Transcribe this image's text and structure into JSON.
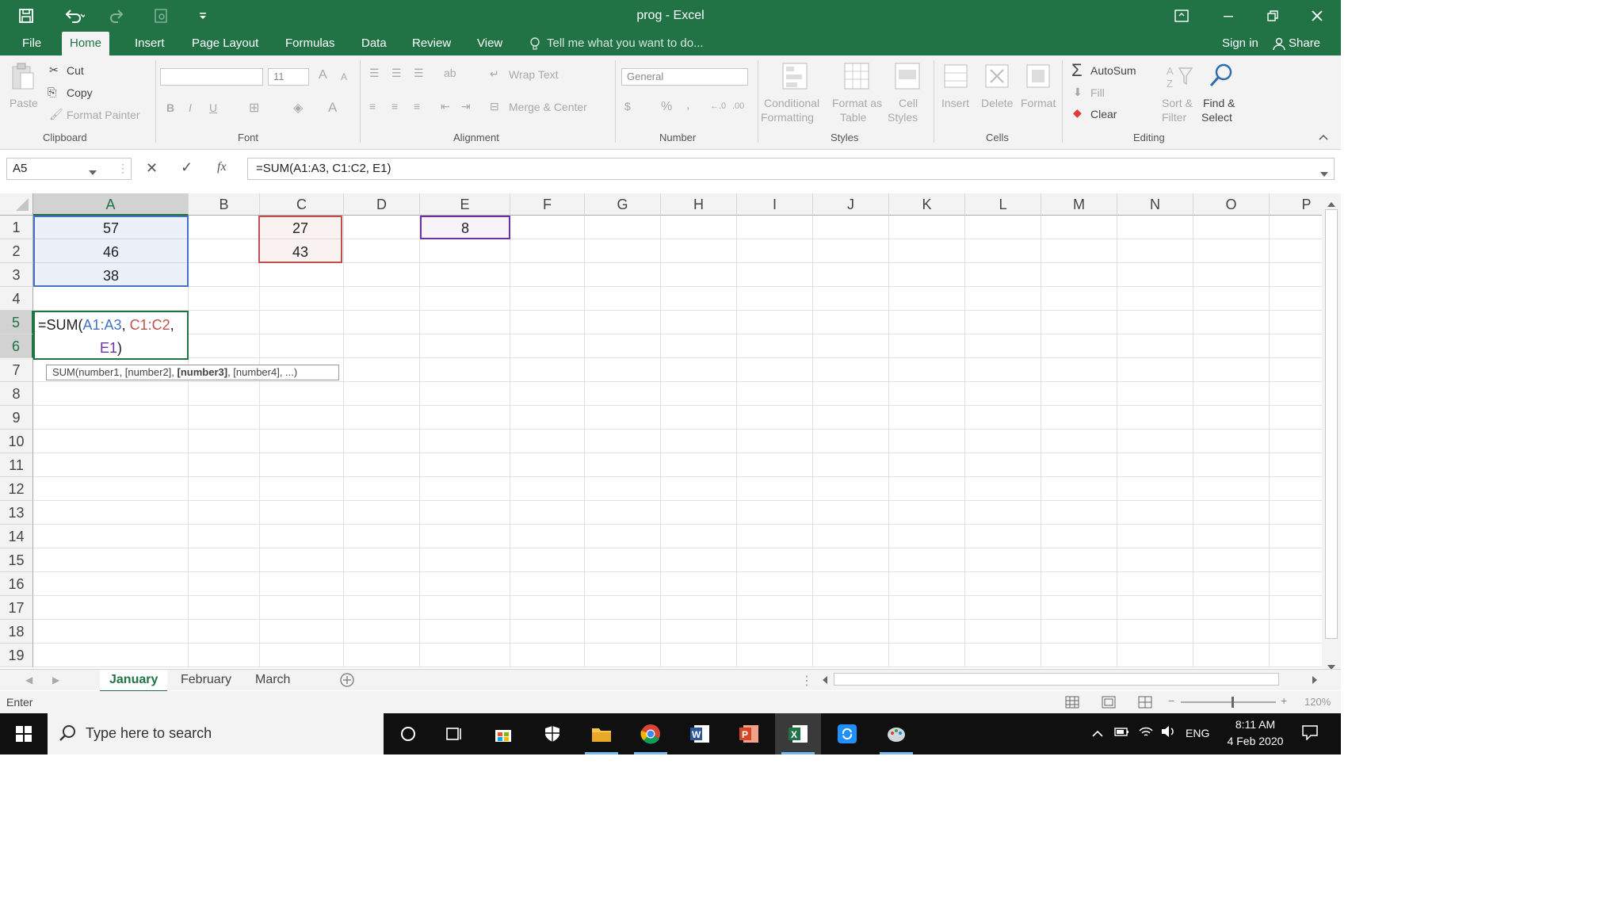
{
  "window": {
    "title": "prog - Excel"
  },
  "ribbon_tabs": [
    {
      "label": "File"
    },
    {
      "label": "Home"
    },
    {
      "label": "Insert"
    },
    {
      "label": "Page Layout"
    },
    {
      "label": "Formulas"
    },
    {
      "label": "Data"
    },
    {
      "label": "Review"
    },
    {
      "label": "View"
    }
  ],
  "tell_me": "Tell me what you want to do...",
  "account": {
    "sign_in": "Sign in",
    "share": "Share"
  },
  "clipboard": {
    "paste": "Paste",
    "cut": "Cut",
    "copy": "Copy",
    "format_painter": "Format Painter",
    "group": "Clipboard"
  },
  "font": {
    "name": "",
    "size": "11",
    "bold": "B",
    "italic": "I",
    "underline": "U",
    "group": "Font",
    "grow": "A",
    "shrink": "A",
    "color": "A"
  },
  "alignment": {
    "wrap_text": "Wrap Text",
    "merge_center": "Merge & Center",
    "group": "Alignment"
  },
  "number": {
    "format": "General",
    "percent": "%",
    "comma": ",",
    "group": "Number"
  },
  "styles": {
    "conditional_1": "Conditional",
    "conditional_2": "Formatting",
    "format_table_1": "Format as",
    "format_table_2": "Table",
    "cell_styles_1": "Cell",
    "cell_styles_2": "Styles",
    "group": "Styles"
  },
  "cells": {
    "insert": "Insert",
    "delete": "Delete",
    "format": "Format",
    "group": "Cells"
  },
  "editing": {
    "autosum": "AutoSum",
    "fill": "Fill",
    "clear": "Clear",
    "sort_1": "Sort &",
    "sort_2": "Filter",
    "find_1": "Find &",
    "find_2": "Select",
    "group": "Editing"
  },
  "formula_bar": {
    "name_box": "A5",
    "cancel": "✕",
    "enter": "✓",
    "fx": "fx",
    "formula": "=SUM(A1:A3, C1:C2, E1)"
  },
  "columns": [
    "A",
    "B",
    "C",
    "D",
    "E",
    "F",
    "G",
    "H",
    "I",
    "J",
    "K",
    "L",
    "M",
    "N",
    "O",
    "P"
  ],
  "rows": [
    "1",
    "2",
    "3",
    "4",
    "5",
    "6",
    "7",
    "8",
    "9",
    "10",
    "11",
    "12",
    "13",
    "14",
    "15",
    "16",
    "17",
    "18",
    "19"
  ],
  "cells_data": {
    "A1": "57",
    "A2": "46",
    "A3": "38",
    "C1": "27",
    "C2": "43",
    "E1": "8"
  },
  "edit_formula": {
    "prefix": "=SUM(",
    "ref1": "A1:A3",
    "sep1": ", ",
    "ref2": "C1:C2",
    "sep2": ",",
    "ref3": "E1",
    "suffix": ")"
  },
  "tooltip": {
    "pre": "SUM(number1, [number2], ",
    "bold": "[number3]",
    "post": ", [number4], ...)"
  },
  "sheets": [
    {
      "label": "January"
    },
    {
      "label": "February"
    },
    {
      "label": "March"
    }
  ],
  "status": {
    "mode": "Enter",
    "zoom": "120%"
  },
  "taskbar": {
    "search_placeholder": "Type here to search",
    "lang": "ENG",
    "time": "8:11 AM",
    "date": "4 Feb 2020"
  },
  "colors": {
    "excel_green": "#217346",
    "ref_blue": "#4472c4",
    "ref_red": "#c0504d",
    "ref_purple": "#7030a0"
  }
}
